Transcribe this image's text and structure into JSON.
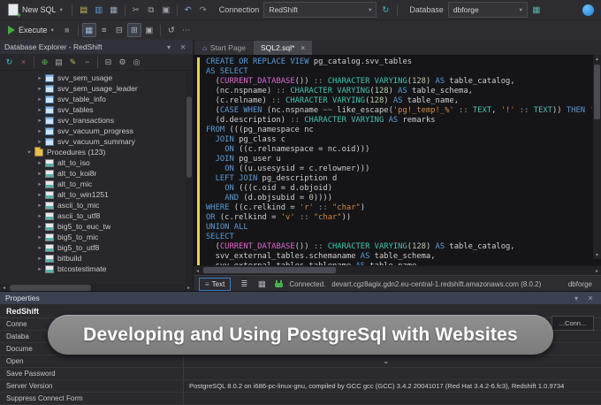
{
  "toolbar_top": {
    "new_sql_label": "New SQL",
    "left_icons": [
      {
        "name": "open-file-icon",
        "glyph": "▤",
        "color": "#c9b45a"
      },
      {
        "name": "save-icon",
        "glyph": "▥",
        "color": "#5b9bd5"
      },
      {
        "name": "save-all-icon",
        "glyph": "▦",
        "color": "#9aa7b8"
      },
      {
        "sep": true
      },
      {
        "name": "cut-icon",
        "glyph": "✂",
        "color": "#9aa0a8"
      },
      {
        "name": "copy-icon",
        "glyph": "⧉",
        "color": "#9aa0a8"
      },
      {
        "name": "paste-icon",
        "glyph": "▣",
        "color": "#9aa0a8"
      },
      {
        "sep": true
      },
      {
        "name": "undo-icon",
        "glyph": "↶",
        "color": "#7fa7d8"
      },
      {
        "name": "redo-icon",
        "glyph": "↷",
        "color": "#8a8f96"
      }
    ],
    "connection_label": "Connection",
    "connection_value": "RedShift",
    "refresh_icon_glyph": "↻",
    "database_label": "Database",
    "database_value": "dbforge",
    "new_database_icon_glyph": "▦"
  },
  "toolbar_exec": {
    "execute_label": "Execute",
    "icons": [
      {
        "name": "stop-icon",
        "glyph": "■",
        "color": "#6d6d72"
      },
      {
        "sep": true
      },
      {
        "name": "results-grid-toggle",
        "glyph": "▦",
        "color": "#9fb7d4",
        "on": true
      },
      {
        "name": "results-text-toggle",
        "glyph": "≡",
        "color": "#a9adb4"
      },
      {
        "name": "split-horizontal-toggle",
        "glyph": "⊟",
        "color": "#a9adb4"
      },
      {
        "name": "split-vertical-toggle",
        "glyph": "⊞",
        "color": "#a9adb4",
        "on": true
      },
      {
        "name": "pin-results-toggle",
        "glyph": "▣",
        "color": "#a9adb4"
      },
      {
        "sep": true
      },
      {
        "name": "query-history-icon",
        "glyph": "↺",
        "color": "#a9adb4"
      },
      {
        "name": "more-icon",
        "glyph": "⋯",
        "color": "#a9adb4"
      }
    ]
  },
  "explorer": {
    "title": "Database Explorer - RedShift",
    "tools": [
      {
        "name": "refresh-icon",
        "glyph": "↻",
        "color": "#3fbfbf"
      },
      {
        "name": "disconnect-icon",
        "glyph": "×",
        "color": "#b05c5c"
      },
      {
        "sep": true
      },
      {
        "name": "new-connection-icon",
        "glyph": "⊕",
        "color": "#57b847"
      },
      {
        "name": "new-sql-icon",
        "glyph": "▤",
        "color": "#a9adb4"
      },
      {
        "name": "edit-icon",
        "glyph": "✎",
        "color": "#c9b45a"
      },
      {
        "name": "delete-icon",
        "glyph": "−",
        "color": "#a9adb4"
      },
      {
        "sep": true
      },
      {
        "name": "collapse-all-icon",
        "glyph": "⊟",
        "color": "#a9adb4"
      },
      {
        "name": "options-icon",
        "glyph": "⚙",
        "color": "#a9adb4"
      },
      {
        "name": "search-icon",
        "glyph": "◎",
        "color": "#a9adb4"
      }
    ],
    "items": [
      {
        "label": "svv_sem_usage",
        "type": "view",
        "indent": 3,
        "expanded": false
      },
      {
        "label": "svv_sem_usage_leader",
        "type": "view",
        "indent": 3,
        "expanded": false
      },
      {
        "label": "svv_table_info",
        "type": "view",
        "indent": 3,
        "expanded": false
      },
      {
        "label": "svv_tables",
        "type": "view",
        "indent": 3,
        "expanded": false
      },
      {
        "label": "svv_transactions",
        "type": "view",
        "indent": 3,
        "expanded": false
      },
      {
        "label": "svv_vacuum_progress",
        "type": "view",
        "indent": 3,
        "expanded": false
      },
      {
        "label": "svv_vacuum_summary",
        "type": "view",
        "indent": 3,
        "expanded": false
      },
      {
        "label": "Procedures (123)",
        "type": "folder",
        "indent": 2,
        "expanded": true
      },
      {
        "label": "alt_to_iso",
        "type": "proc",
        "indent": 3,
        "expanded": false
      },
      {
        "label": "alt_to_koi8r",
        "type": "proc",
        "indent": 3,
        "expanded": false
      },
      {
        "label": "alt_to_mic",
        "type": "proc",
        "indent": 3,
        "expanded": false
      },
      {
        "label": "alt_to_win1251",
        "type": "proc",
        "indent": 3,
        "expanded": false
      },
      {
        "label": "ascii_to_mic",
        "type": "proc",
        "indent": 3,
        "expanded": false
      },
      {
        "label": "ascii_to_utf8",
        "type": "proc",
        "indent": 3,
        "expanded": false
      },
      {
        "label": "big5_to_euc_tw",
        "type": "proc",
        "indent": 3,
        "expanded": false
      },
      {
        "label": "big5_to_mic",
        "type": "proc",
        "indent": 3,
        "expanded": false
      },
      {
        "label": "big5_to_utf8",
        "type": "proc",
        "indent": 3,
        "expanded": false
      },
      {
        "label": "bitbuild",
        "type": "proc",
        "indent": 3,
        "expanded": false
      },
      {
        "label": "btcostestimate",
        "type": "proc",
        "indent": 3,
        "expanded": false
      }
    ]
  },
  "editor": {
    "tabs": [
      {
        "label": "Start Page",
        "name": "tab-start-page",
        "active": false,
        "icon": "⌂",
        "close": false
      },
      {
        "label": "SQL2.sql*",
        "name": "tab-sql2",
        "active": true,
        "icon": "",
        "close": true
      }
    ],
    "lines": [
      [
        [
          "k",
          "CREATE OR REPLACE VIEW"
        ],
        [
          "i",
          " pg_catalog.svv_tables"
        ]
      ],
      [
        [
          "k",
          "AS SELECT"
        ]
      ],
      [
        [
          "i",
          "  ("
        ],
        [
          "f",
          "CURRENT_DATABASE"
        ],
        [
          "i",
          "()) "
        ],
        [
          "o",
          "::"
        ],
        [
          "t",
          " CHARACTER VARYING"
        ],
        [
          "i",
          "("
        ],
        [
          "n",
          "128"
        ],
        [
          "i",
          ") "
        ],
        [
          "k",
          "AS"
        ],
        [
          "i",
          " table_catalog,"
        ]
      ],
      [
        [
          "i",
          "  (nc.nspname) "
        ],
        [
          "o",
          "::"
        ],
        [
          "t",
          " CHARACTER VARYING"
        ],
        [
          "i",
          "("
        ],
        [
          "n",
          "128"
        ],
        [
          "i",
          ") "
        ],
        [
          "k",
          "AS"
        ],
        [
          "i",
          " table_schema,"
        ]
      ],
      [
        [
          "i",
          "  (c.relname) "
        ],
        [
          "o",
          "::"
        ],
        [
          "t",
          " CHARACTER VARYING"
        ],
        [
          "i",
          "("
        ],
        [
          "n",
          "128"
        ],
        [
          "i",
          ") "
        ],
        [
          "k",
          "AS"
        ],
        [
          "i",
          " table_name,"
        ]
      ],
      [
        [
          "i",
          "  ("
        ],
        [
          "k",
          "CASE"
        ],
        [
          "i",
          " "
        ],
        [
          "k",
          "WHEN"
        ],
        [
          "i",
          " (nc.nspname "
        ],
        [
          "o",
          "~~"
        ],
        [
          "i",
          " like_escape("
        ],
        [
          "s",
          "'pg!_temp!_%'"
        ],
        [
          "i",
          " "
        ],
        [
          "o",
          "::"
        ],
        [
          "i",
          " "
        ],
        [
          "t",
          "TEXT"
        ],
        [
          "i",
          ", "
        ],
        [
          "s",
          "'!'"
        ],
        [
          "i",
          " "
        ],
        [
          "o",
          "::"
        ],
        [
          "i",
          " "
        ],
        [
          "t",
          "TEXT"
        ],
        [
          "i",
          ")) "
        ],
        [
          "k",
          "THEN"
        ],
        [
          "i",
          " "
        ],
        [
          "s",
          "'LOCAL TEMPORARY'"
        ]
      ],
      [
        [
          "i",
          "  (d.description) "
        ],
        [
          "o",
          "::"
        ],
        [
          "t",
          " CHARACTER VARYING"
        ],
        [
          "i",
          " "
        ],
        [
          "k",
          "AS"
        ],
        [
          "i",
          " remarks"
        ]
      ],
      [
        [
          "k",
          "FROM"
        ],
        [
          "i",
          " (((pg_namespace nc"
        ]
      ],
      [
        [
          "i",
          "  "
        ],
        [
          "k",
          "JOIN"
        ],
        [
          "i",
          " pg_class c"
        ]
      ],
      [
        [
          "i",
          "    "
        ],
        [
          "k",
          "ON"
        ],
        [
          "i",
          " ((c.relnamespace = nc.oid)))"
        ]
      ],
      [
        [
          "i",
          "  "
        ],
        [
          "k",
          "JOIN"
        ],
        [
          "i",
          " pg_user u"
        ]
      ],
      [
        [
          "i",
          "    "
        ],
        [
          "k",
          "ON"
        ],
        [
          "i",
          " ((u.usesysid = c.relowner)))"
        ]
      ],
      [
        [
          "i",
          "  "
        ],
        [
          "k",
          "LEFT JOIN"
        ],
        [
          "i",
          " pg_description d"
        ]
      ],
      [
        [
          "i",
          "    "
        ],
        [
          "k",
          "ON"
        ],
        [
          "i",
          " (((c.oid = d.objoid)"
        ]
      ],
      [
        [
          "i",
          "    "
        ],
        [
          "k",
          "AND"
        ],
        [
          "i",
          " (d.objsubid = "
        ],
        [
          "n",
          "0"
        ],
        [
          "i",
          "))))"
        ]
      ],
      [
        [
          "k",
          "WHERE"
        ],
        [
          "i",
          " ((c.relkind = "
        ],
        [
          "s",
          "'r'"
        ],
        [
          "i",
          " "
        ],
        [
          "o",
          "::"
        ],
        [
          "i",
          " "
        ],
        [
          "s",
          "\"char\""
        ],
        [
          "i",
          ")"
        ]
      ],
      [
        [
          "k",
          "OR"
        ],
        [
          "i",
          " (c.relkind = "
        ],
        [
          "s",
          "'v'"
        ],
        [
          "i",
          " "
        ],
        [
          "o",
          "::"
        ],
        [
          "i",
          " "
        ],
        [
          "s",
          "\"char\""
        ],
        [
          "i",
          "))"
        ]
      ],
      [
        [
          "k",
          "UNION ALL"
        ]
      ],
      [
        [
          "k",
          "SELECT"
        ]
      ],
      [
        [
          "i",
          "  ("
        ],
        [
          "f",
          "CURRENT_DATABASE"
        ],
        [
          "i",
          "()) "
        ],
        [
          "o",
          "::"
        ],
        [
          "t",
          " CHARACTER VARYING"
        ],
        [
          "i",
          "("
        ],
        [
          "n",
          "128"
        ],
        [
          "i",
          ") "
        ],
        [
          "k",
          "AS"
        ],
        [
          "i",
          " table_catalog,"
        ]
      ],
      [
        [
          "i",
          "  svv_external_tables.schemaname "
        ],
        [
          "k",
          "AS"
        ],
        [
          "i",
          " table_schema,"
        ]
      ],
      [
        [
          "i",
          "  svv_external_tables.tablename "
        ],
        [
          "k",
          "AS"
        ],
        [
          "i",
          " table_name,"
        ]
      ]
    ]
  },
  "statusbar": {
    "text_button_label": "Text",
    "icons": [
      {
        "name": "messages-icon",
        "glyph": "≣",
        "color": "#a9adb4"
      },
      {
        "name": "grid-view-icon",
        "glyph": "▦",
        "color": "#a9adb4"
      }
    ],
    "connected_label": "Connected.",
    "server": "devart.cgz8agix.gdn2.eu-central-1.redshift.amazonaws.com (8.0.2)",
    "database": "dbforge"
  },
  "properties": {
    "title": "Properties",
    "subtitle": "RedShift",
    "window_fragment": "...Conn...",
    "rows": [
      {
        "label": "Conne",
        "value": "",
        "dropdown": false
      },
      {
        "label": "Databa",
        "value": "",
        "dropdown": false
      },
      {
        "label": "Docume",
        "value": "",
        "dropdown": true
      },
      {
        "label": "Open",
        "value": "",
        "dropdown": true
      },
      {
        "label": "Save Password",
        "value": "",
        "dropdown": false
      },
      {
        "label": "Server Version",
        "value": "PostgreSQL 8.0.2 on i686-pc-linux-gnu, compiled by GCC gcc (GCC) 3.4.2 20041017 (Red Hat 3.4.2-6.fc3), Redshift 1.0.9734",
        "dropdown": false
      },
      {
        "label": "Suppress Connect Form",
        "value": "",
        "dropdown": false
      }
    ]
  },
  "overlay": {
    "text": "Developing and Using PostgreSql with Websites"
  }
}
